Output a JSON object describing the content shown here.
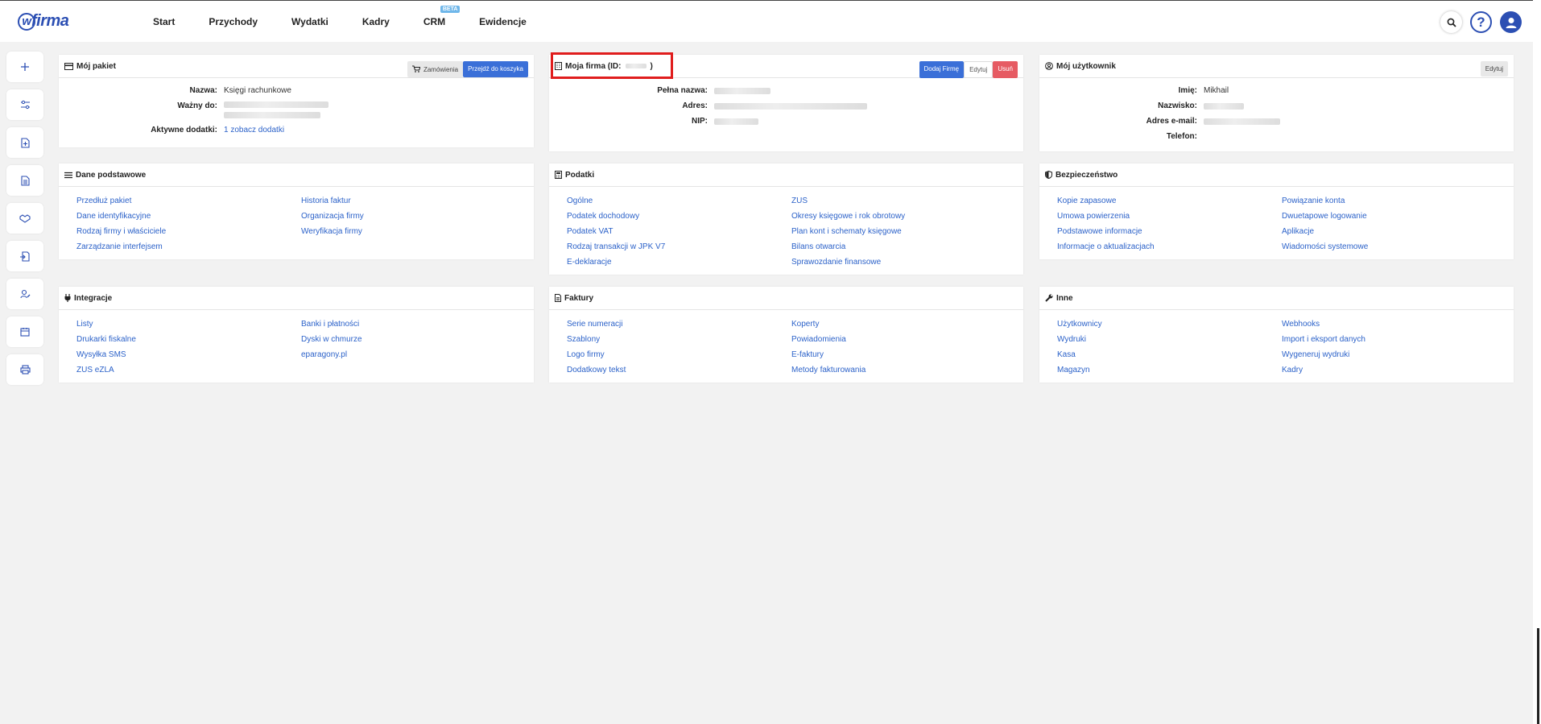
{
  "app": {
    "logo": "firma"
  },
  "nav": [
    "Start",
    "Przychody",
    "Wydatki",
    "Kadry",
    "CRM",
    "Ewidencje"
  ],
  "nav_beta": "BETA",
  "icons": {
    "search": "search-icon",
    "help": "help-icon",
    "user": "user-icon",
    "sidebar": [
      "plus-icon",
      "sliders-icon",
      "add-document-icon",
      "document-icon",
      "handshake-icon",
      "import-icon",
      "user-edit-icon",
      "calendar-icon",
      "printer-icon"
    ]
  },
  "colors": {
    "accent": "#2c4fb3",
    "link": "#2c62c9",
    "danger": "#e65b63",
    "highlight": "#e01d1d"
  },
  "package": {
    "title": "Mój pakiet",
    "orders_btn": "Zamówienia",
    "cart_btn": "Przejdź do koszyka",
    "rows": [
      {
        "label": "Nazwa:",
        "value": "Księgi rachunkowe"
      },
      {
        "label": "Ważny do:",
        "value": ""
      },
      {
        "label": "Aktywne dodatki:",
        "value": "1 zobacz dodatki"
      }
    ]
  },
  "company": {
    "title": "Moja firma (ID:",
    "title_end": ")",
    "add_btn": "Dodaj Firmę",
    "edit_btn": "Edytuj",
    "delete_btn": "Usuń",
    "rows": [
      {
        "label": "Pełna nazwa:"
      },
      {
        "label": "Adres:"
      },
      {
        "label": "NIP:"
      }
    ]
  },
  "user": {
    "title": "Mój użytkownik",
    "edit_btn": "Edytuj",
    "rows": [
      {
        "label": "Imię:",
        "value": "Mikhail"
      },
      {
        "label": "Nazwisko:",
        "value": ""
      },
      {
        "label": "Adres e-mail:",
        "value": ""
      },
      {
        "label": "Telefon:",
        "value": ""
      }
    ]
  },
  "sections": [
    {
      "title": "Dane podstawowe",
      "links": [
        "Przedłuż pakiet",
        "Historia faktur",
        "Dane identyfikacyjne",
        "Organizacja firmy",
        "Rodzaj firmy i właściciele",
        "Weryfikacja firmy",
        "Zarządzanie interfejsem"
      ]
    },
    {
      "title": "Podatki",
      "links": [
        "Ogólne",
        "ZUS",
        "Podatek dochodowy",
        "Okresy księgowe i rok obrotowy",
        "Podatek VAT",
        "Plan kont i schematy księgowe",
        "Rodzaj transakcji w JPK V7",
        "Bilans otwarcia",
        "E-deklaracje",
        "Sprawozdanie finansowe"
      ]
    },
    {
      "title": "Bezpieczeństwo",
      "links": [
        "Kopie zapasowe",
        "Powiązanie konta",
        "Umowa powierzenia",
        "Dwuetapowe logowanie",
        "Podstawowe informacje",
        "Aplikacje",
        "Informacje o aktualizacjach",
        "Wiadomości systemowe"
      ]
    },
    {
      "title": "Integracje",
      "links": [
        "Listy",
        "Banki i płatności",
        "Drukarki fiskalne",
        "Dyski w chmurze",
        "Wysyłka SMS",
        "eparagony.pl",
        "ZUS eZLA"
      ]
    },
    {
      "title": "Faktury",
      "links": [
        "Serie numeracji",
        "Koperty",
        "Szablony",
        "Powiadomienia",
        "Logo firmy",
        "E-faktury",
        "Dodatkowy tekst",
        "Metody fakturowania"
      ]
    },
    {
      "title": "Inne",
      "links": [
        "Użytkownicy",
        "Webhooks",
        "Wydruki",
        "Import i eksport danych",
        "Kasa",
        "Wygeneruj wydruki",
        "Magazyn",
        "Kadry"
      ]
    }
  ]
}
